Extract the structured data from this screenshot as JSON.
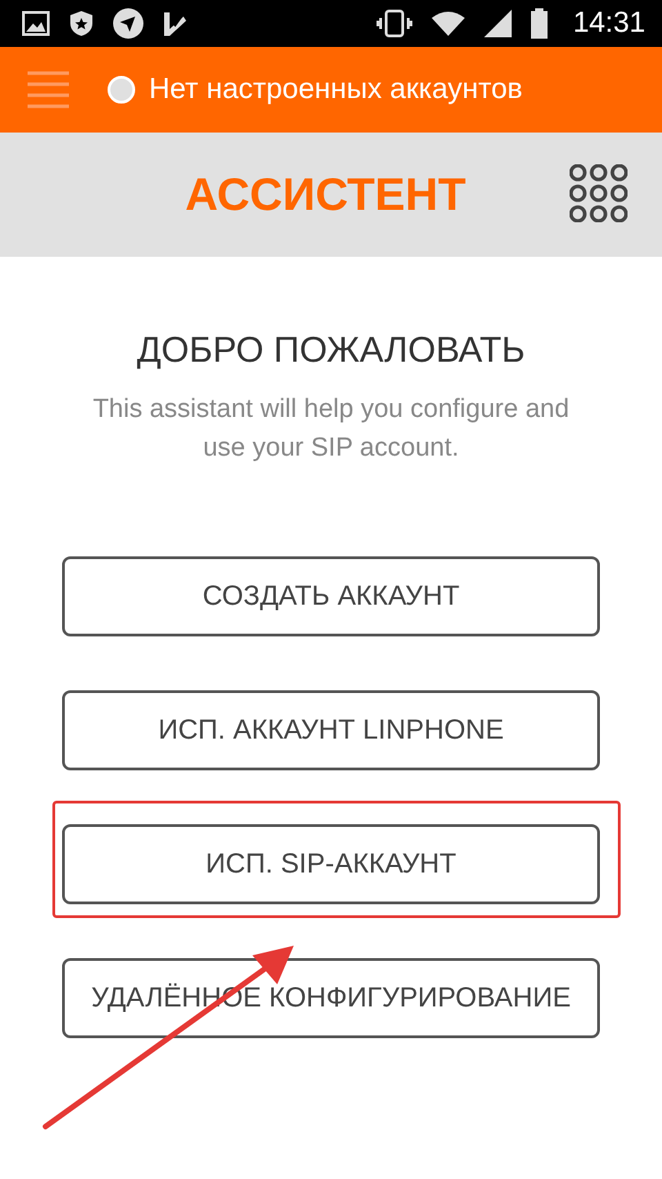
{
  "status_bar": {
    "time": "14:31"
  },
  "top_bar": {
    "status_text": "Нет настроенных аккаунтов"
  },
  "header": {
    "title": "АССИСТЕНТ"
  },
  "welcome": {
    "title": "ДОБРО ПОЖАЛОВАТЬ",
    "description": "This assistant will help you configure and use your SIP account."
  },
  "buttons": [
    {
      "label": "СОЗДАТЬ АККАУНТ",
      "highlighted": false
    },
    {
      "label": "ИСП. АККАУНТ LINPHONE",
      "highlighted": false
    },
    {
      "label": "ИСП. SIP-АККАУНТ",
      "highlighted": true
    },
    {
      "label": "УДАЛЁННОЕ КОНФИГУРИРОВАНИЕ",
      "highlighted": false
    }
  ]
}
